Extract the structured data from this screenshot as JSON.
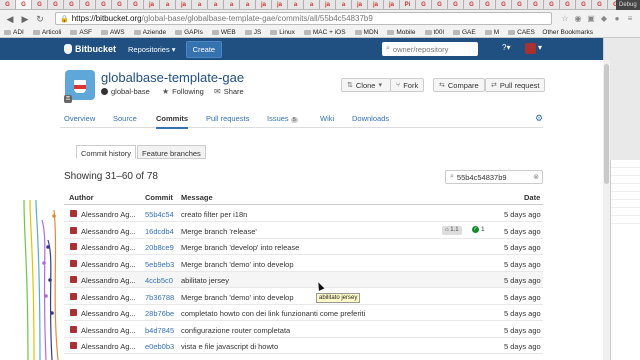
{
  "browser": {
    "tab_glyphs": [
      "G",
      "G",
      "G",
      "G",
      "G",
      "G",
      "G",
      "G",
      "G",
      "ja",
      "a",
      "ja",
      "a",
      "a",
      "a",
      "a",
      "ja",
      "ja",
      "a",
      "a",
      "ja",
      "a",
      "ja",
      "ja",
      "ja",
      "Pi",
      "G",
      "G",
      "G",
      "G",
      "G",
      "G",
      "G",
      "G",
      "G",
      "G",
      "G",
      "G",
      "G"
    ],
    "debug_label": "Debug",
    "url_host": "https://bitbucket.org",
    "url_path": "/global-base/globalbase-template-gae/commits/all/55b4c54837b9",
    "bookmarks": [
      "ADI",
      "Articoli",
      "ASF",
      "AWS",
      "Aziende",
      "GAPIs",
      "WEB",
      "JS",
      "Linux",
      "MAC + iOS",
      "MDN",
      "Mobile",
      "t00l",
      "GAE",
      "M",
      "CAES"
    ],
    "other_bookmarks": "Other Bookmarks"
  },
  "bitbucket": {
    "logo": "Bitbucket",
    "repositories_menu": "Repositories ▾",
    "create_label": "Create",
    "search_placeholder": "owner/repository"
  },
  "repo": {
    "name": "globalbase-template-gae",
    "owner": "global-base",
    "follow_label": "Following",
    "share_label": "Share",
    "actions": {
      "clone": "Clone",
      "fork": "Fork",
      "compare": "Compare",
      "pull_request": "Pull request"
    }
  },
  "tabs": [
    {
      "label": "Overview"
    },
    {
      "label": "Source"
    },
    {
      "label": "Commits"
    },
    {
      "label": "Pull requests"
    },
    {
      "label": "Issues",
      "count": "5"
    },
    {
      "label": "Wiki"
    },
    {
      "label": "Downloads"
    }
  ],
  "sub_tabs": {
    "history": "Commit history",
    "branches": "Feature branches"
  },
  "commits": {
    "title": "Showing 31–60 of 78",
    "search_value": "55b4c54837b9",
    "headers": {
      "author": "Author",
      "commit": "Commit",
      "message": "Message",
      "date": "Date"
    },
    "rows": [
      {
        "author": "Alessandro Ag...",
        "hash": "55b4c54",
        "message": "creato filter per i18n",
        "date": "5 days ago"
      },
      {
        "author": "Alessandro Ag...",
        "hash": "16dcdb4",
        "message": "Merge branch 'release'",
        "date": "5 days ago",
        "tag": "1.1",
        "build": "1"
      },
      {
        "author": "Alessandro Ag...",
        "hash": "20b8ce9",
        "message": "Merge branch 'develop' into release",
        "date": "5 days ago"
      },
      {
        "author": "Alessandro Ag...",
        "hash": "5eb9eb3",
        "message": "Merge branch 'demo' into develop",
        "date": "5 days ago"
      },
      {
        "author": "Alessandro Ag...",
        "hash": "4ccb5c0",
        "message": "abilitato jersey",
        "date": "5 days ago"
      },
      {
        "author": "Alessandro Ag...",
        "hash": "7b36788",
        "message": "Merge branch 'demo' into develop",
        "date": "5 days ago"
      },
      {
        "author": "Alessandro Ag...",
        "hash": "28b76be",
        "message": "completato howto con dei link funzionanti come preferiti",
        "date": "5 days ago"
      },
      {
        "author": "Alessandro Ag...",
        "hash": "b4d7845",
        "message": "configurazione router completata",
        "date": "5 days ago"
      },
      {
        "author": "Alessandro Ag...",
        "hash": "e0eb0b3",
        "message": "vista e file javascript di howto",
        "date": "5 days ago"
      }
    ]
  },
  "tooltip": "abilitato jersey",
  "colors": {
    "header": "#205081",
    "link": "#3572b0",
    "graph_lines": [
      "#6cc644",
      "#e5c100",
      "#5fa6d9",
      "#b36bd2",
      "#3a3a8c",
      "#e28a3b"
    ]
  }
}
